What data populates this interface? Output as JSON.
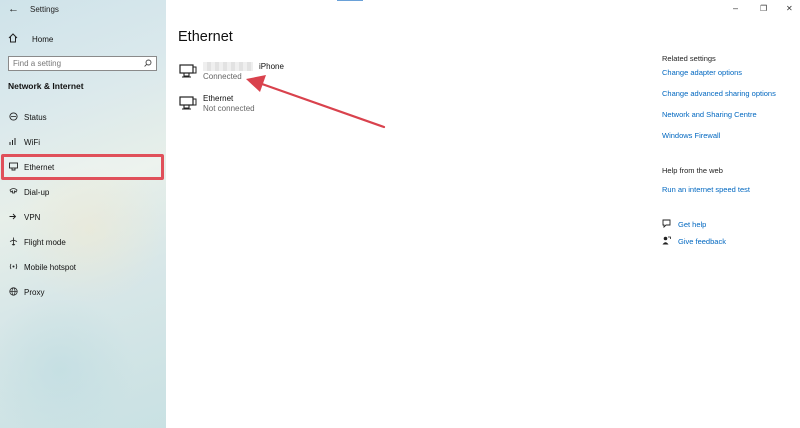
{
  "window": {
    "title": "Settings",
    "back_glyph": "←",
    "controls": [
      "–",
      "❐",
      "✕"
    ]
  },
  "sidebar": {
    "home_label": "Home",
    "search_placeholder": "Find a setting",
    "section_title": "Network & Internet",
    "items": [
      {
        "label": "Status",
        "icon": "status-icon",
        "glyph": "⊕"
      },
      {
        "label": "WiFi",
        "icon": "wifi-icon",
        "glyph": "◜"
      },
      {
        "label": "Ethernet",
        "icon": "ethernet-icon",
        "glyph": "▭",
        "selected": true
      },
      {
        "label": "Dial-up",
        "icon": "dialup-icon",
        "glyph": "☎"
      },
      {
        "label": "VPN",
        "icon": "vpn-icon",
        "glyph": "⟴"
      },
      {
        "label": "Flight mode",
        "icon": "airplane-icon",
        "glyph": "✈"
      },
      {
        "label": "Mobile hotspot",
        "icon": "hotspot-icon",
        "glyph": "◉"
      },
      {
        "label": "Proxy",
        "icon": "globe-icon",
        "glyph": "⊕"
      }
    ]
  },
  "main": {
    "title": "Ethernet",
    "connections": [
      {
        "name": "iPhone",
        "status": "Connected",
        "name_redacted": true
      },
      {
        "name": "Ethernet",
        "status": "Not connected",
        "name_redacted": false
      }
    ]
  },
  "related_settings": {
    "heading": "Related settings",
    "links": [
      "Change adapter options",
      "Change advanced sharing options",
      "Network and Sharing Centre",
      "Windows Firewall"
    ]
  },
  "help": {
    "heading": "Help from the web",
    "links": [
      "Run an internet speed test"
    ]
  },
  "support": {
    "get_help": "Get help",
    "give_feedback": "Give feedback"
  },
  "colors": {
    "accent": "#0067c0",
    "highlight": "#e0505a",
    "arrow": "#d9424d"
  }
}
